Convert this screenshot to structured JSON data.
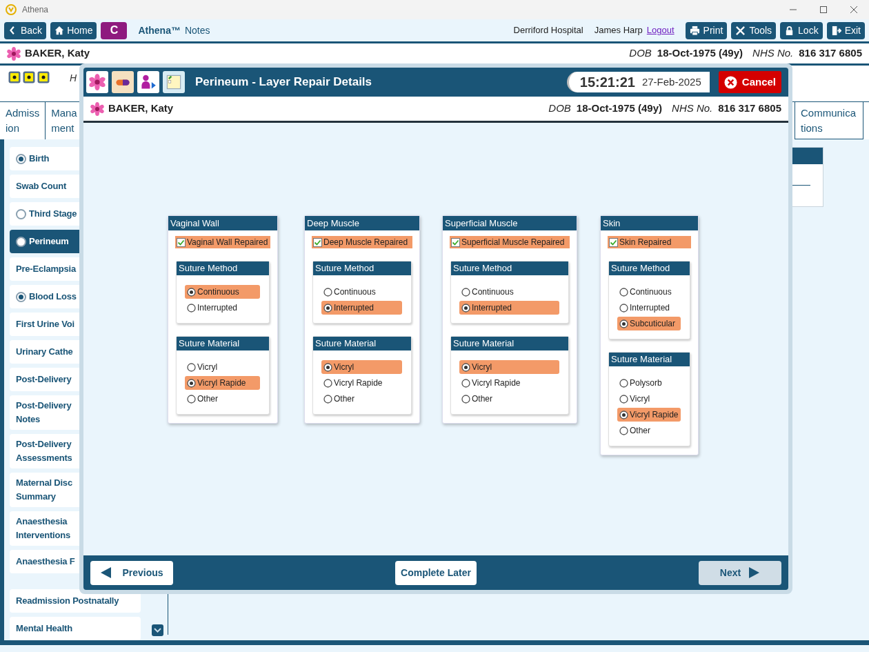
{
  "window": {
    "title": "Athena"
  },
  "toolbar": {
    "nav_buttons": [
      "Back",
      "Home"
    ],
    "c_button": "C",
    "app_name": "Athena™",
    "app_suffix": "Notes",
    "hospital": "Derriford Hospital",
    "user": "James Harp",
    "logout": "Logout",
    "actions": [
      "Print",
      "Tools",
      "Lock",
      "Exit"
    ]
  },
  "patient": {
    "name": "BAKER, Katy",
    "dob_label": "DOB",
    "dob": "18-Oct-1975 (49y)",
    "nhs_label": "NHS No.",
    "nhs": "816 317 6805"
  },
  "alerts_text": "H",
  "tabs": [
    {
      "lines": [
        "Admiss",
        "ion"
      ]
    },
    {
      "lines": [
        "Mana",
        "ment"
      ]
    },
    {
      "lines": [
        "Communica",
        "tions"
      ]
    }
  ],
  "sidebar": {
    "items": [
      {
        "label": "Birth",
        "kind": "radio",
        "checked": true,
        "selected": false
      },
      {
        "label": "Swab Count",
        "kind": "plain",
        "selected": false
      },
      {
        "label": "Third Stage",
        "kind": "radio",
        "checked": false,
        "selected": false
      },
      {
        "label": "Perineum",
        "kind": "radio",
        "checked": false,
        "selected": true
      },
      {
        "label": "Pre-Eclampsia",
        "kind": "plain",
        "selected": false
      },
      {
        "label": "Blood Loss",
        "kind": "radio",
        "checked": true,
        "selected": false
      },
      {
        "label": "First Urine Voi",
        "kind": "plain",
        "selected": false
      },
      {
        "label": "Urinary Cathe",
        "kind": "plain",
        "selected": false
      },
      {
        "label": "Post-Delivery",
        "kind": "plain",
        "selected": false
      },
      {
        "label": "Post-Delivery Notes",
        "kind": "wrapped",
        "selected": false
      },
      {
        "label": "Post-Delivery Assessments",
        "kind": "wrapped",
        "selected": false
      },
      {
        "label": "Maternal Disc Summary",
        "kind": "wrapped",
        "selected": false
      },
      {
        "label": "Anaesthesia Interventions",
        "kind": "wrapped",
        "selected": false
      },
      {
        "label": "Anaesthesia F",
        "kind": "plain",
        "selected": false
      }
    ],
    "lower_items": [
      {
        "label": "Readmission Postnatally",
        "kind": "plain",
        "selected": false
      },
      {
        "label": "Mental Health",
        "kind": "plain",
        "selected": false
      }
    ]
  },
  "dialog": {
    "title": "Perineum - Layer Repair Details",
    "time": "15:21:21",
    "date": "27-Feb-2025",
    "cancel": "Cancel",
    "patient": {
      "name": "BAKER, Katy",
      "dob_label": "DOB",
      "dob": "18-Oct-1975 (49y)",
      "nhs_label": "NHS No.",
      "nhs": "816 317 6805"
    },
    "sections": [
      {
        "title": "Vaginal Wall",
        "repaired_label": "Vaginal Wall Repaired",
        "repaired": true,
        "groups": [
          {
            "title": "Suture Method",
            "options": [
              {
                "label": "Continuous",
                "selected": true
              },
              {
                "label": "Interrupted",
                "selected": false
              }
            ]
          },
          {
            "title": "Suture Material",
            "options": [
              {
                "label": "Vicryl",
                "selected": false
              },
              {
                "label": "Vicryl Rapide",
                "selected": true
              },
              {
                "label": "Other",
                "selected": false
              }
            ]
          }
        ]
      },
      {
        "title": "Deep Muscle",
        "repaired_label": "Deep Muscle Repaired",
        "repaired": true,
        "groups": [
          {
            "title": "Suture Method",
            "options": [
              {
                "label": "Continuous",
                "selected": false
              },
              {
                "label": "Interrupted",
                "selected": true
              }
            ]
          },
          {
            "title": "Suture Material",
            "options": [
              {
                "label": "Vicryl",
                "selected": true
              },
              {
                "label": "Vicryl Rapide",
                "selected": false
              },
              {
                "label": "Other",
                "selected": false
              }
            ]
          }
        ]
      },
      {
        "title": "Superficial Muscle",
        "repaired_label": "Superficial Muscle Repaired",
        "repaired": true,
        "groups": [
          {
            "title": "Suture Method",
            "options": [
              {
                "label": "Continuous",
                "selected": false
              },
              {
                "label": "Interrupted",
                "selected": true
              }
            ]
          },
          {
            "title": "Suture Material",
            "options": [
              {
                "label": "Vicryl",
                "selected": true
              },
              {
                "label": "Vicryl Rapide",
                "selected": false
              },
              {
                "label": "Other",
                "selected": false
              }
            ]
          }
        ]
      },
      {
        "title": "Skin",
        "repaired_label": "Skin Repaired",
        "repaired": true,
        "groups": [
          {
            "title": "Suture Method",
            "options": [
              {
                "label": "Continuous",
                "selected": false
              },
              {
                "label": "Interrupted",
                "selected": false
              },
              {
                "label": "Subcuticular",
                "selected": true
              }
            ]
          },
          {
            "title": "Suture Material",
            "options": [
              {
                "label": "Polysorb",
                "selected": false
              },
              {
                "label": "Vicryl",
                "selected": false
              },
              {
                "label": "Vicryl Rapide",
                "selected": true
              },
              {
                "label": "Other",
                "selected": false
              }
            ]
          }
        ]
      }
    ],
    "footer": {
      "previous": "Previous",
      "complete_later": "Complete Later",
      "next": "Next",
      "next_disabled": true
    }
  }
}
